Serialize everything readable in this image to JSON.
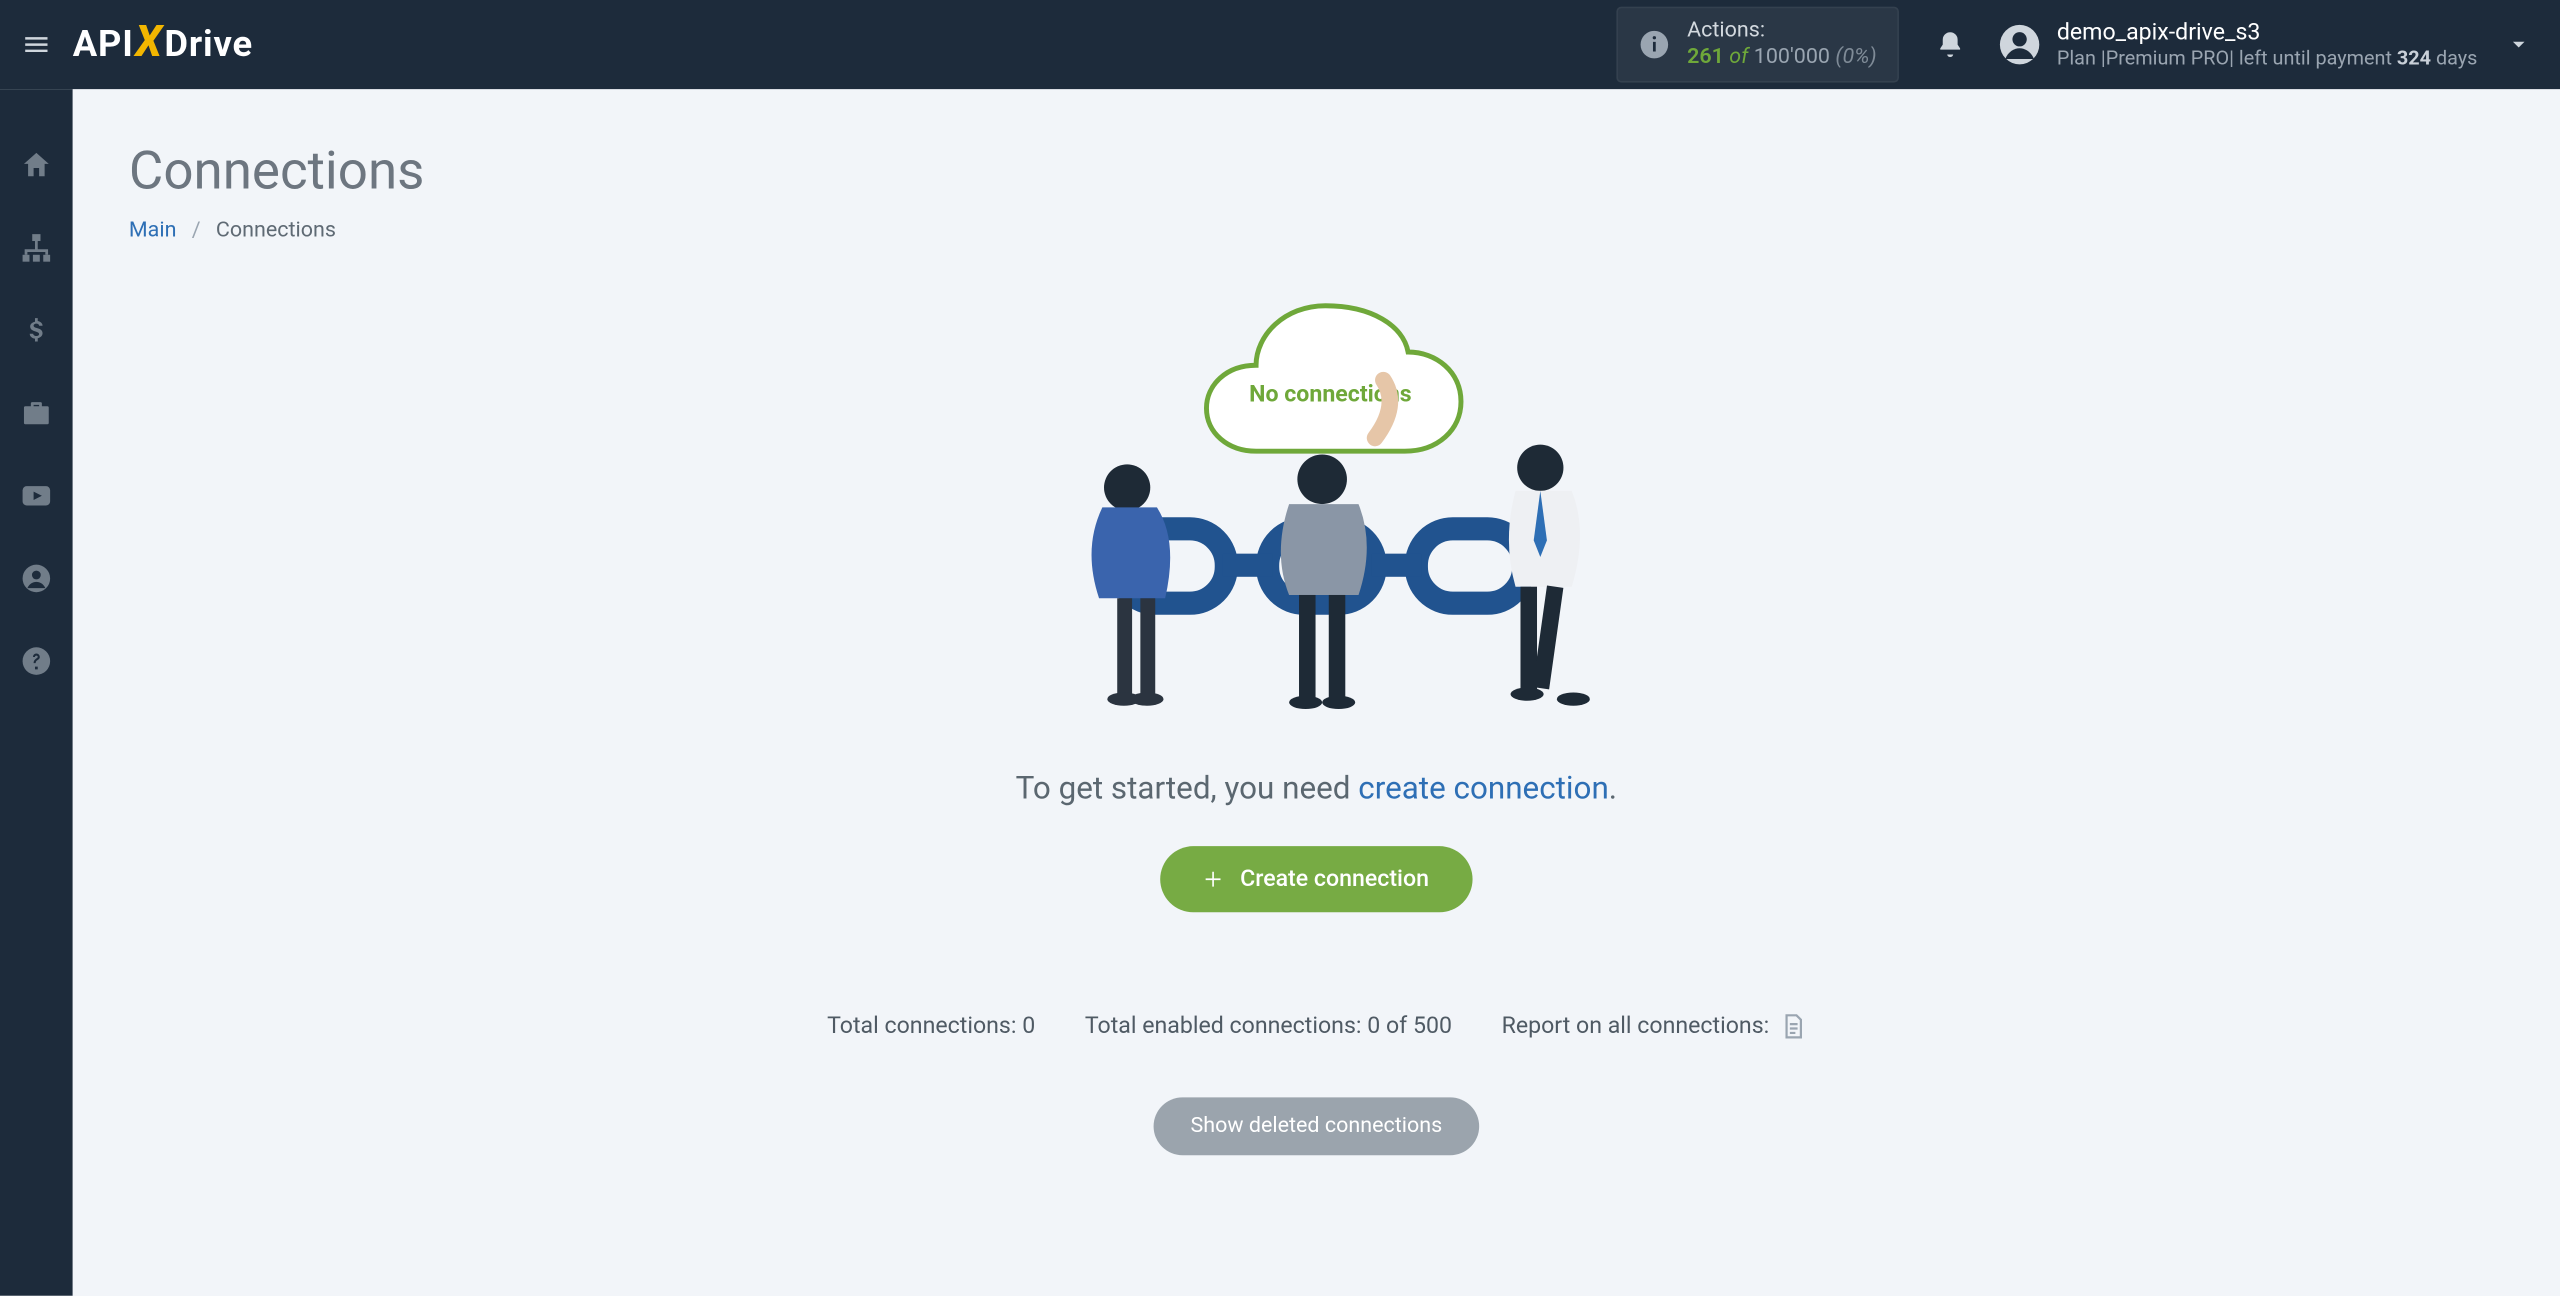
{
  "header": {
    "actions_label": "Actions:",
    "actions_used": "261",
    "actions_of": "of",
    "actions_total": "100'000",
    "actions_pct": "(0%)",
    "user_name": "demo_apix-drive_s3",
    "plan_prefix": "Plan |",
    "plan_name": "Premium PRO",
    "plan_mid": "| left until payment ",
    "plan_days": "324",
    "plan_days_suffix": " days"
  },
  "page": {
    "title": "Connections",
    "breadcrumb_main": "Main",
    "breadcrumb_current": "Connections"
  },
  "empty": {
    "cloud_text": "No connections",
    "lead_text_1": "To get started, you need ",
    "lead_link": "create connection",
    "lead_text_2": ".",
    "create_btn": "Create connection"
  },
  "stats": {
    "total_label": "Total connections: ",
    "total_value": "0",
    "enabled_label": "Total enabled connections: ",
    "enabled_value": "0 of 500",
    "report_label": "Report on all connections:"
  },
  "deleted_btn": "Show deleted connections"
}
